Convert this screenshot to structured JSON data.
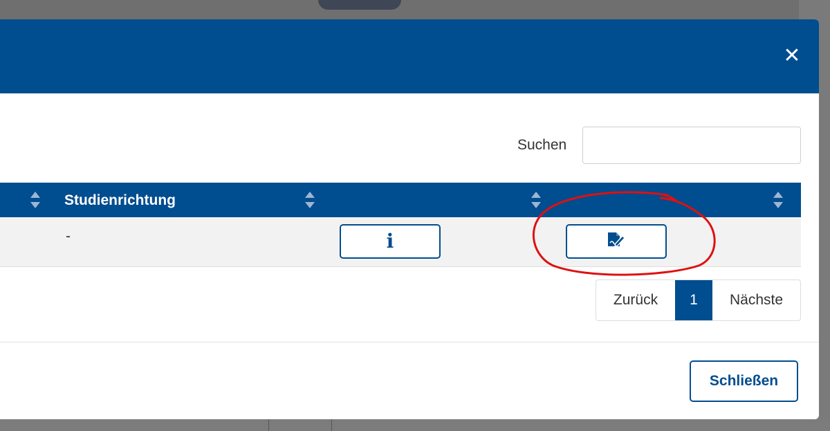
{
  "modal": {
    "close_icon": "times-icon",
    "close_glyph": "✕"
  },
  "search": {
    "label": "Suchen",
    "value": "",
    "placeholder": ""
  },
  "table": {
    "columns": [
      {
        "label": "",
        "sortable": true
      },
      {
        "label": "Studienrichtung",
        "sortable": true
      },
      {
        "label": "",
        "sortable": true
      },
      {
        "label": "",
        "sortable": true
      }
    ],
    "rows": [
      {
        "studienrichtung": "-",
        "info_icon": "info-icon",
        "info_glyph": "i",
        "edit_icon": "document-edit-icon"
      }
    ]
  },
  "pagination": {
    "prev_label": "Zurück",
    "current_page": "1",
    "next_label": "Nächste"
  },
  "footer": {
    "close_label": "Schließen"
  },
  "colors": {
    "primary": "#004d8f",
    "annotation": "#e01010",
    "row_background": "#f2f2f2"
  }
}
